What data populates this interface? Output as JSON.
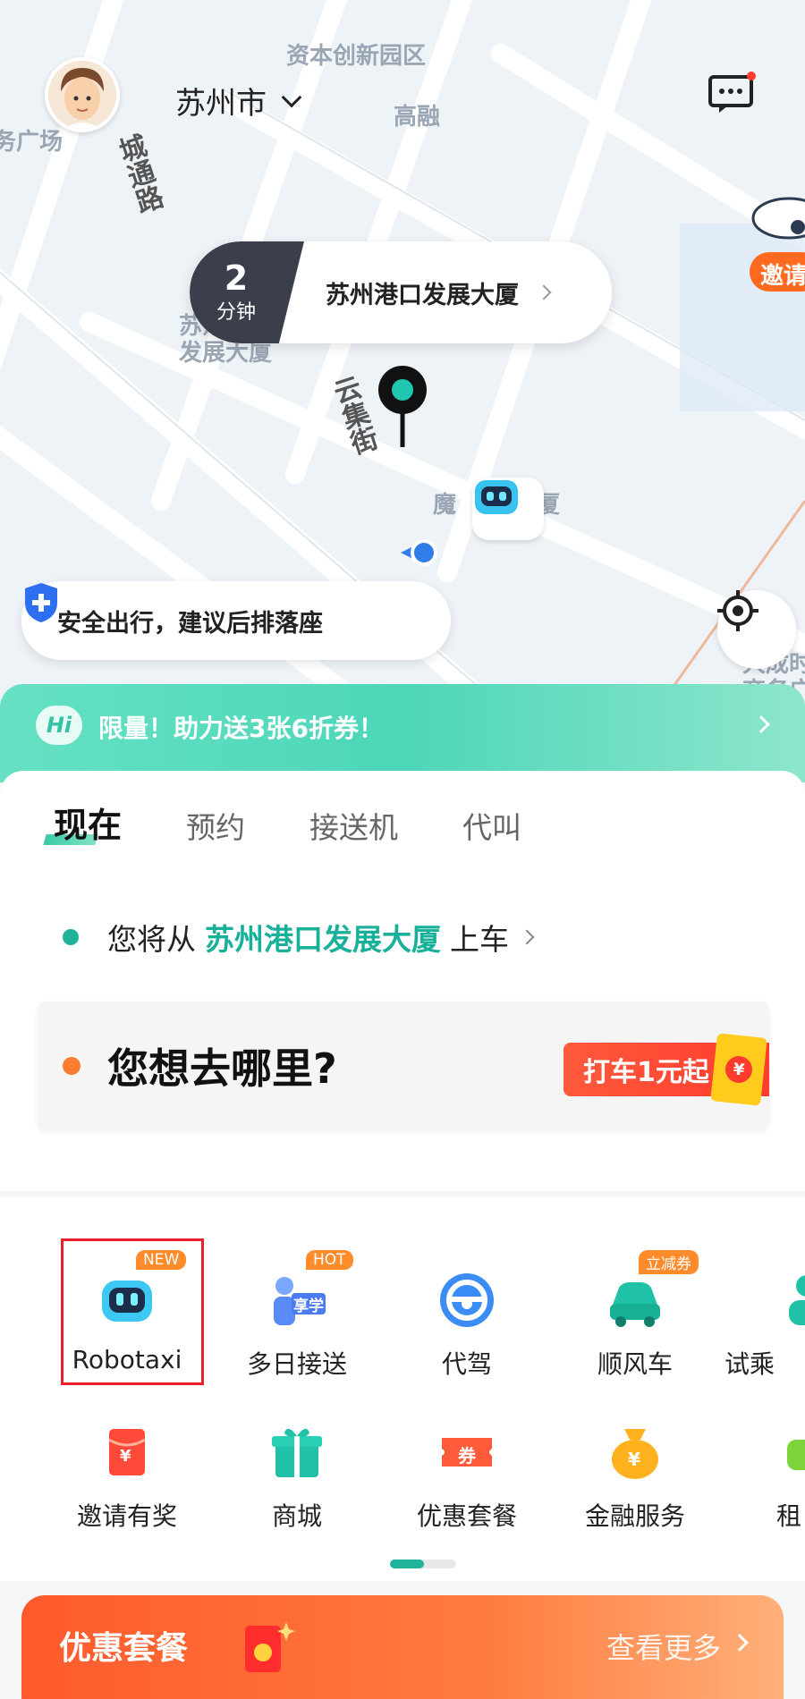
{
  "map": {
    "labels": {
      "park": "资本创新园区",
      "gaorong": "高融",
      "guangchang": "务广场",
      "road_chengtong": "城通路",
      "road_yunji": "云集街",
      "building_partial": "苏州港口发展大厦",
      "mofang_left": "魔",
      "mofang_right": "厦",
      "right_building_1": "大成时",
      "right_building_2": "商务广"
    },
    "eta": {
      "value": "2",
      "unit": "分钟",
      "place": "苏州港口发展大厦"
    },
    "safety_tip": "安全出行，建议后排落座",
    "invite_float": "邀请"
  },
  "header": {
    "city": "苏州市"
  },
  "promo": {
    "badge": "Hi",
    "text": "限量！助力送3张6折券！"
  },
  "tabs": [
    "现在",
    "预约",
    "接送机",
    "代叫"
  ],
  "pickup": {
    "prefix": "您将从",
    "place": "苏州港口发展大厦",
    "suffix": "上车"
  },
  "destination": {
    "placeholder": "您想去哪里?",
    "badge": "打车1元起",
    "coin": "¥"
  },
  "services_row1": [
    {
      "label": "Robotaxi",
      "tag": "NEW"
    },
    {
      "label": "多日接送",
      "tag": "HOT"
    },
    {
      "label": "代驾",
      "tag": ""
    },
    {
      "label": "顺风车",
      "tag": "立减券"
    },
    {
      "label": "试乘",
      "tag": ""
    }
  ],
  "services_row2": [
    {
      "label": "邀请有奖"
    },
    {
      "label": "商城"
    },
    {
      "label": "优惠套餐"
    },
    {
      "label": "金融服务"
    },
    {
      "label": "租"
    }
  ],
  "icon_text": {
    "study": "享学",
    "voucher": "券",
    "yen": "¥"
  },
  "bottom_banner": {
    "title": "优惠套餐",
    "more": "查看更多"
  },
  "colors": {
    "accent": "#1fb39a",
    "orange": "#ff7b31",
    "red": "#ff3b2e"
  }
}
